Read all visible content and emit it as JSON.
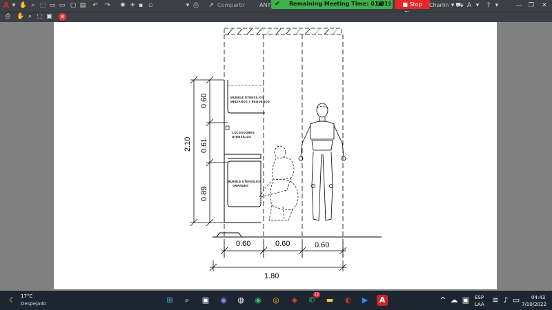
{
  "titlebar": {
    "share_label": "Compartir",
    "doc_title": "ANTO",
    "meeting_text": "Remaining Meeting Time: 01:01",
    "stop_share_label": "Stop Share",
    "user_name": "Charlin"
  },
  "drawing": {
    "dim_total_height": "2.10",
    "dim_top_height": "0.60",
    "dim_mid_height": "0.61",
    "dim_low_height": "0.89",
    "dim_width_1": "0.60",
    "dim_width_2": "0.60",
    "dim_width_3": "0.60",
    "dim_total_width": "1.80",
    "label_upper_1": "MUEBLE UTENSILIOS",
    "label_upper_2": "MEDIANOS Y PEQUEÑOS",
    "label_mid_1": "COLGADORES",
    "label_mid_2": "UTENSILIOS",
    "label_low_1": "MUEBLE UTENSILIOS",
    "label_low_2": "GRANDES"
  },
  "taskbar": {
    "weather_temp": "17°C",
    "weather_desc": "Despejado",
    "whatsapp_badge": "12",
    "lang_1": "ESP",
    "lang_2": "LAA",
    "time": "04:43",
    "date": "7/10/2022"
  },
  "colors": {
    "meeting_green": "#3fb14a",
    "stop_red": "#e8262b",
    "taskbar_bg": "#1c2530"
  }
}
